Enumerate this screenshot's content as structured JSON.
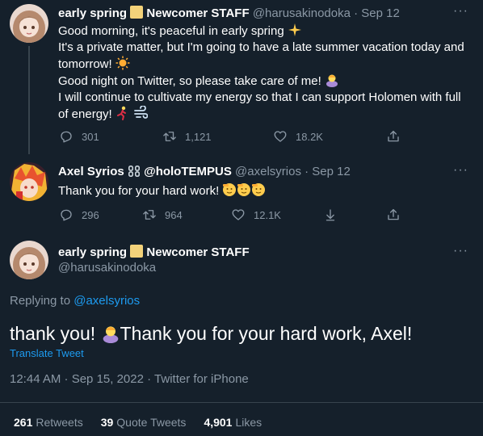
{
  "tweet1": {
    "name": "early spring",
    "name_suffix": "Newcomer STAFF",
    "handle": "@harusakinodoka",
    "dot": "·",
    "date": "Sep 12",
    "more": "···",
    "lines": [
      "Good morning, it's peaceful in early spring",
      "It's a private matter, but I'm going to have a late summer vacation today and",
      "tomorrow!",
      "Good night on Twitter, so please take care of me!",
      "I will continue to cultivate my energy so that I can support Holomen with full",
      "of energy!"
    ],
    "replies": "301",
    "retweets": "1,121",
    "likes": "18.2K"
  },
  "tweet2": {
    "name": "Axel Syrios",
    "name_suffix": "@holoTEMPUS",
    "handle": "@axelsyrios",
    "dot": "·",
    "date": "Sep 12",
    "more": "···",
    "text": "Thank you for your hard work!",
    "replies": "296",
    "retweets": "964",
    "likes": "12.1K"
  },
  "main_tweet": {
    "name": "early spring",
    "name_suffix": "Newcomer STAFF",
    "handle": "@harusakinodoka",
    "more": "···",
    "replying_label": "Replying to",
    "replying_handle": "@axelsyrios",
    "text_part1": "thank you!",
    "text_part2": "Thank you for your hard work, Axel!",
    "translate": "Translate Tweet",
    "timestamp": "12:44 AM · Sep 15, 2022",
    "dot": "·",
    "source": "Twitter for iPhone",
    "stats": {
      "retweets_count": "261",
      "retweets_label": "Retweets",
      "quotes_count": "39",
      "quotes_label": "Quote Tweets",
      "likes_count": "4,901",
      "likes_label": "Likes"
    }
  },
  "icons": {
    "reply": "reply-icon",
    "retweet": "retweet-icon",
    "like": "heart-icon",
    "share": "share-icon",
    "hide": "hide-reply-icon"
  },
  "colors": {
    "background": "#15202b",
    "text": "#ffffff",
    "muted": "#8b98a5",
    "accent": "#1d9bf0",
    "border": "#38444d"
  }
}
